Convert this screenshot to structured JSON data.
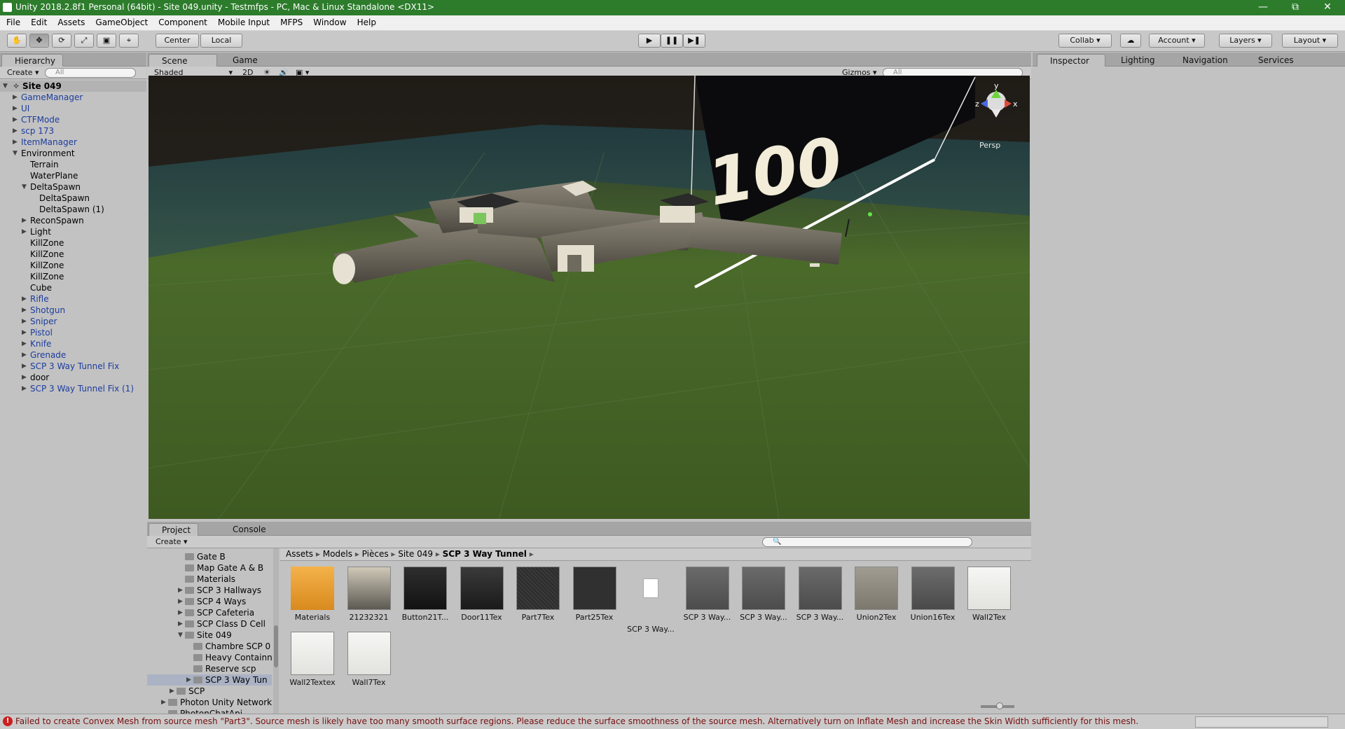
{
  "window": {
    "title": "Unity 2018.2.8f1 Personal (64bit) - Site 049.unity - Testmfps - PC, Mac & Linux Standalone <DX11>"
  },
  "menu": [
    "File",
    "Edit",
    "Assets",
    "GameObject",
    "Component",
    "Mobile Input",
    "MFPS",
    "Window",
    "Help"
  ],
  "toolbar": {
    "pivot": "Center",
    "space": "Local",
    "collab": "Collab",
    "account": "Account",
    "layers": "Layers",
    "layout": "Layout"
  },
  "hierarchy": {
    "tab": "Hierarchy",
    "create": "Create",
    "search_placeholder": "All",
    "scene": "Site 049",
    "items": [
      {
        "label": "GameManager",
        "depth": 1,
        "blue": true,
        "arrow": "right"
      },
      {
        "label": "UI",
        "depth": 1,
        "blue": true,
        "arrow": "right"
      },
      {
        "label": "CTFMode",
        "depth": 1,
        "blue": true,
        "arrow": "right"
      },
      {
        "label": "scp 173",
        "depth": 1,
        "blue": true,
        "arrow": "right"
      },
      {
        "label": "ItemManager",
        "depth": 1,
        "blue": true,
        "arrow": "right"
      },
      {
        "label": "Environment",
        "depth": 1,
        "blue": false,
        "arrow": "down"
      },
      {
        "label": "Terrain",
        "depth": 2,
        "blue": false,
        "arrow": ""
      },
      {
        "label": "WaterPlane",
        "depth": 2,
        "blue": false,
        "arrow": ""
      },
      {
        "label": "DeltaSpawn",
        "depth": 2,
        "blue": false,
        "arrow": "down"
      },
      {
        "label": "DeltaSpawn",
        "depth": 3,
        "blue": false,
        "arrow": ""
      },
      {
        "label": "DeltaSpawn (1)",
        "depth": 3,
        "blue": false,
        "arrow": ""
      },
      {
        "label": "ReconSpawn",
        "depth": 2,
        "blue": false,
        "arrow": "right"
      },
      {
        "label": "Light",
        "depth": 2,
        "blue": false,
        "arrow": "right"
      },
      {
        "label": "KillZone",
        "depth": 2,
        "blue": false,
        "arrow": ""
      },
      {
        "label": "KillZone",
        "depth": 2,
        "blue": false,
        "arrow": ""
      },
      {
        "label": "KillZone",
        "depth": 2,
        "blue": false,
        "arrow": ""
      },
      {
        "label": "KillZone",
        "depth": 2,
        "blue": false,
        "arrow": ""
      },
      {
        "label": "Cube",
        "depth": 2,
        "blue": false,
        "arrow": ""
      },
      {
        "label": "Rifle",
        "depth": 2,
        "blue": true,
        "arrow": "right"
      },
      {
        "label": "Shotgun",
        "depth": 2,
        "blue": true,
        "arrow": "right"
      },
      {
        "label": "Sniper",
        "depth": 2,
        "blue": true,
        "arrow": "right"
      },
      {
        "label": "Pistol",
        "depth": 2,
        "blue": true,
        "arrow": "right"
      },
      {
        "label": "Knife",
        "depth": 2,
        "blue": true,
        "arrow": "right"
      },
      {
        "label": "Grenade",
        "depth": 2,
        "blue": true,
        "arrow": "right"
      },
      {
        "label": "SCP 3 Way Tunnel Fix",
        "depth": 2,
        "blue": true,
        "arrow": "right"
      },
      {
        "label": "door",
        "depth": 2,
        "blue": false,
        "arrow": "right"
      },
      {
        "label": "SCP 3 Way Tunnel Fix (1)",
        "depth": 2,
        "blue": true,
        "arrow": "right"
      }
    ]
  },
  "scene_view": {
    "tabs": [
      "Scene",
      "Game"
    ],
    "shading": "Shaded",
    "mode_2d": "2D",
    "gizmos": "Gizmos",
    "search_placeholder": "All",
    "overlay_number": "100",
    "projection": "Persp",
    "axis_x": "x",
    "axis_y": "y",
    "axis_z": "z"
  },
  "inspector": {
    "tabs": [
      "Inspector",
      "Lighting",
      "Navigation",
      "Services"
    ]
  },
  "project": {
    "tabs": [
      "Project",
      "Console"
    ],
    "create": "Create",
    "tree": [
      {
        "label": "Gate B",
        "depth": 3,
        "arrow": ""
      },
      {
        "label": "Map Gate A & B",
        "depth": 3,
        "arrow": ""
      },
      {
        "label": "Materials",
        "depth": 3,
        "arrow": ""
      },
      {
        "label": "SCP 3 Hallways",
        "depth": 3,
        "arrow": "right"
      },
      {
        "label": "SCP 4 Ways",
        "depth": 3,
        "arrow": "right"
      },
      {
        "label": "SCP Cafeteria",
        "depth": 3,
        "arrow": "right"
      },
      {
        "label": "SCP Class D Cell",
        "depth": 3,
        "arrow": "right"
      },
      {
        "label": "Site 049",
        "depth": 3,
        "arrow": "down"
      },
      {
        "label": "Chambre SCP 0",
        "depth": 4,
        "arrow": ""
      },
      {
        "label": "Heavy Containn",
        "depth": 4,
        "arrow": ""
      },
      {
        "label": "Reserve scp",
        "depth": 4,
        "arrow": ""
      },
      {
        "label": "SCP 3 Way Tun",
        "depth": 4,
        "arrow": "right",
        "selected": true
      },
      {
        "label": "SCP",
        "depth": 2,
        "arrow": "right"
      },
      {
        "label": "Photon Unity Networkin",
        "depth": 1,
        "arrow": "right"
      },
      {
        "label": "PhotonChatApi",
        "depth": 1,
        "arrow": ""
      }
    ],
    "breadcrumb": [
      "Assets",
      "Models",
      "Pièces",
      "Site 049",
      "SCP 3 Way Tunnel"
    ],
    "assets": [
      {
        "label": "Materials",
        "kind": "folder"
      },
      {
        "label": "21232321",
        "kind": "tex-room"
      },
      {
        "label": "Button21T...",
        "kind": "tex-panel"
      },
      {
        "label": "Door11Tex",
        "kind": "tex-door"
      },
      {
        "label": "Part7Tex",
        "kind": "tex-dark"
      },
      {
        "label": "Part25Tex",
        "kind": "tex-dark2"
      },
      {
        "label": "SCP 3 Way...",
        "kind": "file"
      },
      {
        "label": "SCP 3 Way...",
        "kind": "model"
      },
      {
        "label": "SCP 3 Way...",
        "kind": "model"
      },
      {
        "label": "SCP 3 Way...",
        "kind": "model2"
      },
      {
        "label": "Union2Tex",
        "kind": "tex-stone"
      },
      {
        "label": "Union16Tex",
        "kind": "tex-rock"
      },
      {
        "label": "Wall2Tex",
        "kind": "tex-white"
      },
      {
        "label": "Wall2Textex",
        "kind": "tex-white"
      },
      {
        "label": "Wall7Tex",
        "kind": "tex-white"
      }
    ]
  },
  "status": {
    "message": "Failed to create Convex Mesh from source mesh \"Part3\". Source mesh is likely have too many smooth surface regions. Please reduce the surface smoothness of the source mesh. Alternatively turn on Inflate Mesh and increase the Skin Width sufficiently for this mesh."
  }
}
